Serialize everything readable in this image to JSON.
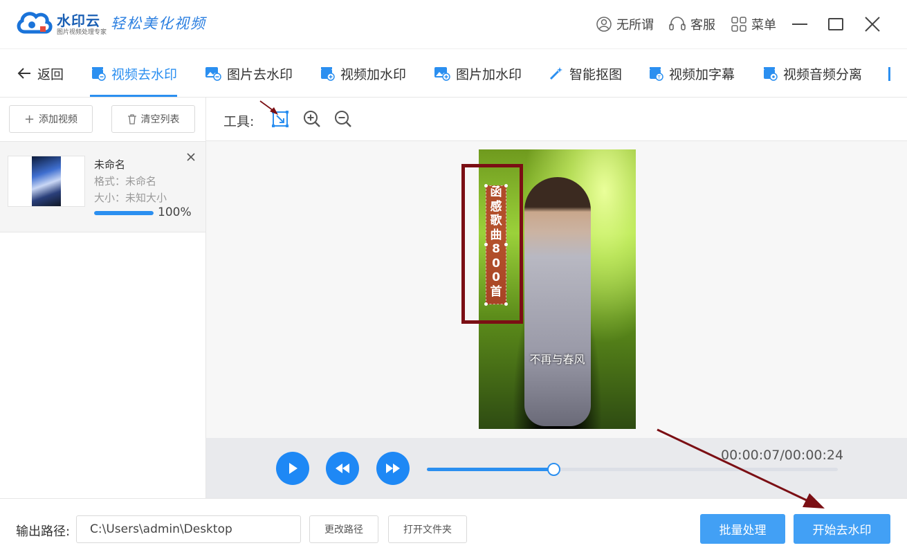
{
  "titlebar": {
    "brand": "水印云",
    "brand_sub": "图片视频处理专家",
    "slogan": "轻松美化视频",
    "user_label": "无所谓",
    "service_label": "客服",
    "menu_label": "菜单"
  },
  "tabs": {
    "back_label": "返回",
    "items": [
      {
        "label": "视频去水印",
        "icon": "video-icon",
        "active": true
      },
      {
        "label": "图片去水印",
        "icon": "image-icon"
      },
      {
        "label": "视频加水印",
        "icon": "video-icon"
      },
      {
        "label": "图片加水印",
        "icon": "image-icon"
      },
      {
        "label": "智能抠图",
        "icon": "magic-wand-icon"
      },
      {
        "label": "视频加字幕",
        "icon": "video-icon"
      },
      {
        "label": "视频音频分离",
        "icon": "video-icon"
      }
    ]
  },
  "left": {
    "add_video_label": "添加视频",
    "clear_list_label": "清空列表",
    "file": {
      "name": "未命名",
      "format": "格式：未命名",
      "size": "大小：未知大小",
      "progress": 1.0,
      "progress_text": "100%"
    }
  },
  "workspace": {
    "tools_label": "工具:",
    "watermark_text": [
      "函",
      "感",
      "歌",
      "曲",
      "8",
      "0",
      "0",
      "首"
    ],
    "subtitle_text": "不再与春风",
    "time_text": "00:00:07/00:00:24",
    "playback_fraction": 0.308
  },
  "bottom": {
    "output_label": "输出路径:",
    "output_path": "C:\\Users\\admin\\Desktop",
    "change_path_label": "更改路径",
    "open_folder_label": "打开文件夹",
    "batch_label": "批量处理",
    "start_label": "开始去水印"
  },
  "colors": {
    "accent": "#2b8ff0",
    "primary_button": "#42a0f5",
    "annotation": "#7b0f14"
  }
}
